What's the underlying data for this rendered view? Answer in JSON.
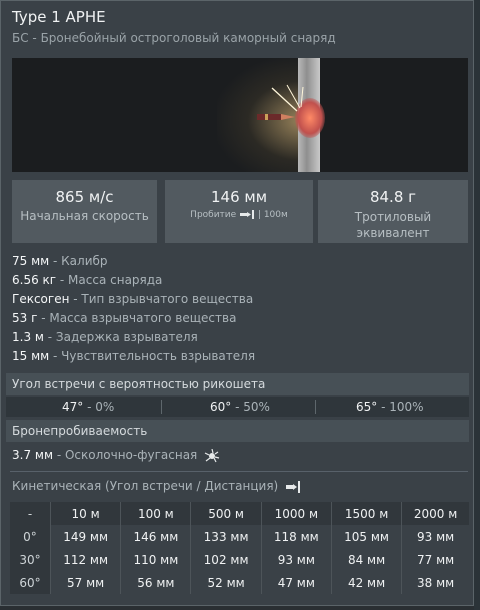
{
  "header": {
    "title": "Type 1 APHE",
    "subtitle": "БС - Бронебойный остроголовый каморный снаряд"
  },
  "stats": [
    {
      "value": "865 м/с",
      "label": "Начальная скорость"
    },
    {
      "value": "146 мм",
      "label_a": "Пробитие",
      "label_b": "| 100м"
    },
    {
      "value": "84.8 г",
      "label": "Тротиловый эквивалент"
    }
  ],
  "props": [
    {
      "value": "75 мм",
      "desc": " - Калибр"
    },
    {
      "value": "6.56 кг",
      "desc": " - Масса снаряда"
    },
    {
      "value": "Гексоген",
      "desc": " - Тип взрывчатого вещества"
    },
    {
      "value": "53 г",
      "desc": " - Масса взрывчатого вещества"
    },
    {
      "value": "1.3 м",
      "desc": " - Задержка взрывателя"
    },
    {
      "value": "15 мм",
      "desc": " - Чувствительность взрывателя"
    }
  ],
  "ricochet": {
    "title": "Угол встречи с вероятностью рикошета",
    "cells": [
      {
        "angle": "47°",
        "prob": " - 0%"
      },
      {
        "angle": "60°",
        "prob": " - 50%"
      },
      {
        "angle": "65°",
        "prob": " - 100%"
      }
    ]
  },
  "penetration": {
    "title": "Бронепробиваемость",
    "he_value": "3.7 мм",
    "he_desc": " - Осколочно-фугасная",
    "kinetic_title": "Кинетическая (Угол встречи / Дистанция)",
    "headers": [
      "-",
      "10 м",
      "100 м",
      "500 м",
      "1000 м",
      "1500 м",
      "2000 м"
    ],
    "rows": [
      [
        "0°",
        "149 мм",
        "146 мм",
        "133 мм",
        "118 мм",
        "105 мм",
        "93 мм"
      ],
      [
        "30°",
        "112 мм",
        "110 мм",
        "102 мм",
        "93 мм",
        "84 мм",
        "77 мм"
      ],
      [
        "60°",
        "57 мм",
        "56 мм",
        "52 мм",
        "47 мм",
        "42 мм",
        "38 мм"
      ]
    ]
  },
  "colors": {
    "panel": "#3a4147",
    "stat_box": "#525a60",
    "section": "#475056"
  }
}
